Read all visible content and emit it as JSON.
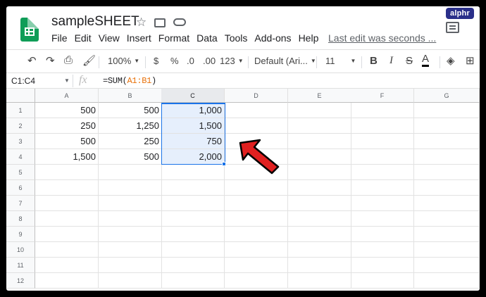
{
  "brand": "alphr",
  "document": {
    "title": "sampleSHEET",
    "last_edit": "Last edit was seconds ..."
  },
  "menu": [
    "File",
    "Edit",
    "View",
    "Insert",
    "Format",
    "Data",
    "Tools",
    "Add-ons",
    "Help"
  ],
  "toolbar": {
    "zoom": "100%",
    "currency": "$",
    "percent": "%",
    "decrease_decimal": ".0",
    "increase_decimal": ".00",
    "more_formats": "123",
    "font": "Default (Ari...",
    "font_size": "11",
    "bold": "B",
    "italic": "I",
    "strikethrough": "S",
    "text_color": "A",
    "text_color_value": "#000000"
  },
  "formula_bar": {
    "name_box": "C1:C4",
    "fx": "fx",
    "formula_prefix": "=SUM(",
    "formula_ref": "A1:B1",
    "formula_suffix": ")"
  },
  "grid": {
    "columns": [
      "A",
      "B",
      "C",
      "D",
      "E",
      "F",
      "G"
    ],
    "rows": [
      "1",
      "2",
      "3",
      "4",
      "5",
      "6",
      "7",
      "8",
      "9",
      "10",
      "11",
      "12"
    ],
    "cells": [
      [
        "500",
        "500",
        "1,000"
      ],
      [
        "250",
        "1,250",
        "1,500"
      ],
      [
        "500",
        "250",
        "750"
      ],
      [
        "1,500",
        "500",
        "2,000"
      ]
    ],
    "selected_column": "C",
    "selection_color": "#1a73e8"
  },
  "annotation": {
    "arrow_color": "#e02020"
  }
}
